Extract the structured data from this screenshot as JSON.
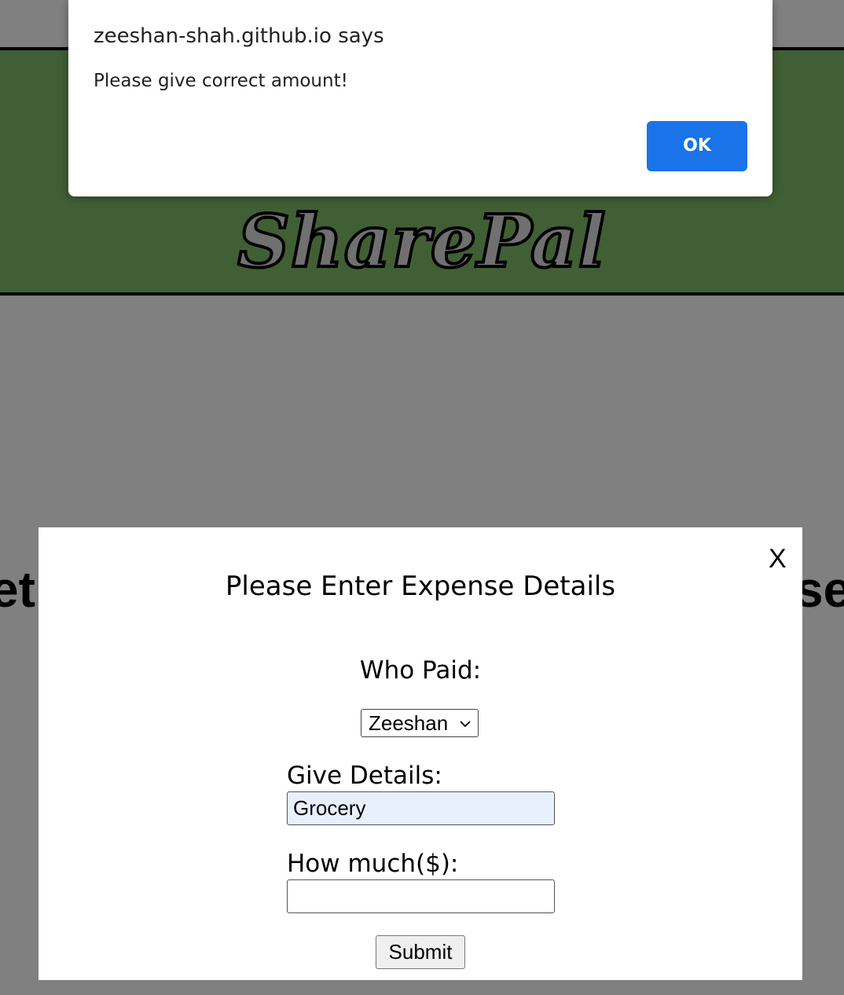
{
  "alert": {
    "origin": "zeeshan-shah.github.io says",
    "message": "Please give correct amount!",
    "ok_label": "OK"
  },
  "header": {
    "logo_text": "SharePal"
  },
  "background": {
    "heading_left_fragment": "et",
    "heading_right_fragment": "se"
  },
  "modal": {
    "close_label": "X",
    "title": "Please Enter Expense Details",
    "who_paid_label": "Who Paid:",
    "who_paid_selected": "Zeeshan",
    "details_label": "Give Details:",
    "details_value": "Grocery",
    "amount_label": "How much($):",
    "amount_value": "",
    "submit_label": "Submit"
  },
  "colors": {
    "header_bg": "#415f35",
    "overlay_bg": "#808080",
    "ok_button": "#1a73e8",
    "autofill_bg": "#e8f0fe"
  }
}
